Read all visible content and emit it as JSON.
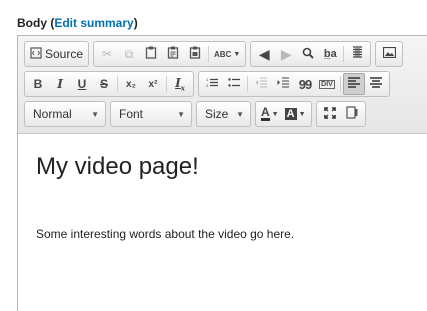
{
  "field": {
    "label": "Body",
    "link_open": " (",
    "link_text": "Edit summary",
    "link_close": ")"
  },
  "toolbar": {
    "source_label": "Source",
    "spellcheck_label": "ABC",
    "bold": "B",
    "italic": "I",
    "underline": "U",
    "strike": "S",
    "subscript": "x₂",
    "superscript": "x²",
    "remove_format": "Ix",
    "blockquote": "99",
    "div": "DIV",
    "format_select": "Normal",
    "font_select": "Font",
    "size_select": "Size",
    "text_color": "A",
    "bg_color": "A"
  },
  "content": {
    "heading": "My video page!",
    "paragraph": "Some interesting words about the video go here."
  }
}
